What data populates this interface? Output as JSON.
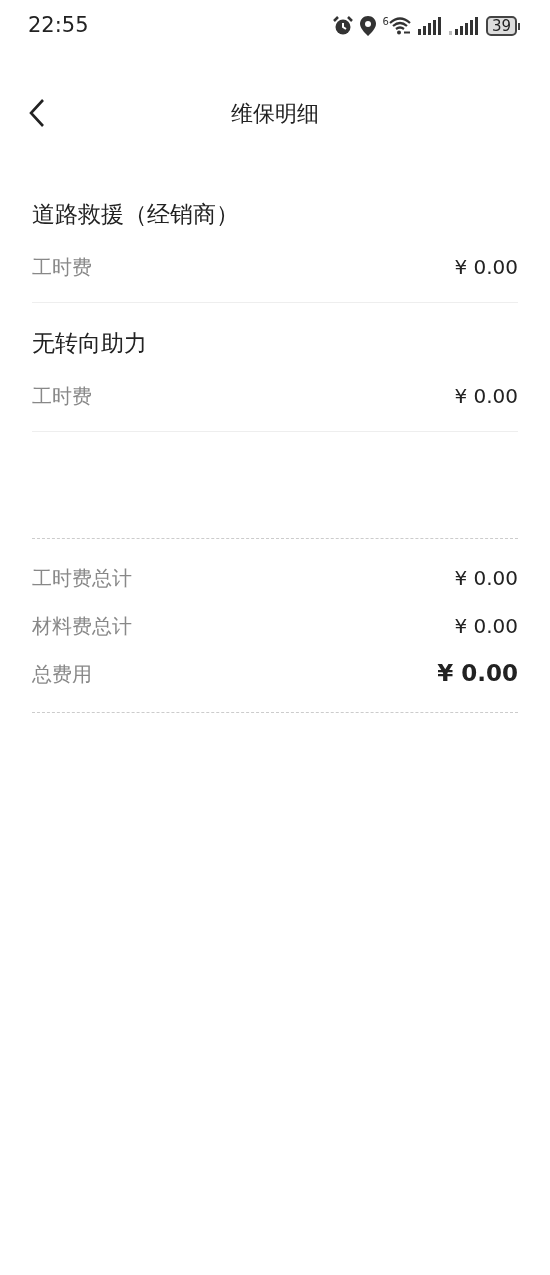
{
  "status_bar": {
    "time": "22:55",
    "wifi_badge": "6",
    "battery": "39"
  },
  "header": {
    "title": "维保明细"
  },
  "items": [
    {
      "name": "道路救援（经销商）",
      "fees": [
        {
          "label": "工时费",
          "amount": "¥ 0.00"
        }
      ]
    },
    {
      "name": "无转向助力",
      "fees": [
        {
          "label": "工时费",
          "amount": "¥ 0.00"
        }
      ]
    }
  ],
  "totals": [
    {
      "kind": "subtotal",
      "label": "工时费总计",
      "amount": "¥ 0.00"
    },
    {
      "kind": "subtotal",
      "label": "材料费总计",
      "amount": "¥ 0.00"
    },
    {
      "kind": "grand",
      "label": "总费用",
      "amount": "¥ 0.00"
    }
  ]
}
